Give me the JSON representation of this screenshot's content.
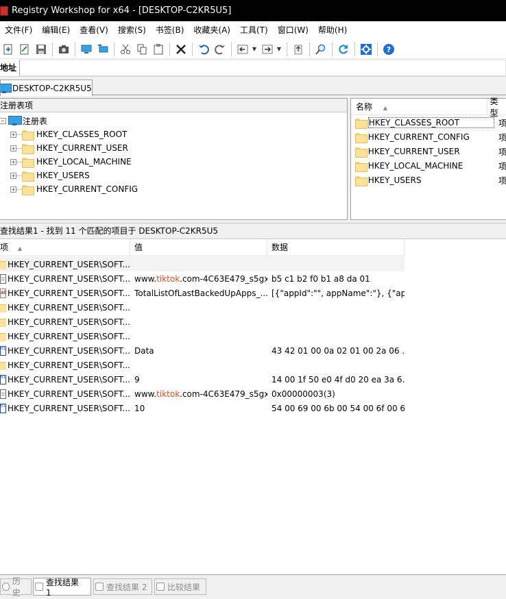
{
  "window": {
    "title": "Registry Workshop for x64 - [DESKTOP-C2KR5U5]"
  },
  "menu": [
    "文件(F)",
    "编辑(E)",
    "查看(V)",
    "搜索(S)",
    "书签(B)",
    "收藏夹(A)",
    "工具(T)",
    "窗口(W)",
    "帮助(H)"
  ],
  "address": {
    "label": "地址",
    "value": ""
  },
  "tab": {
    "label": "DESKTOP-C2KR5U5"
  },
  "tree": {
    "header": "注册表项",
    "root": "注册表",
    "items": [
      "HKEY_CLASSES_ROOT",
      "HKEY_CURRENT_USER",
      "HKEY_LOCAL_MACHINE",
      "HKEY_USERS",
      "HKEY_CURRENT_CONFIG"
    ]
  },
  "list": {
    "col_name": "名称",
    "col_type": "类型",
    "rows": [
      {
        "name": "HKEY_CLASSES_ROOT",
        "type": "项"
      },
      {
        "name": "HKEY_CURRENT_CONFIG",
        "type": "项"
      },
      {
        "name": "HKEY_CURRENT_USER",
        "type": "项"
      },
      {
        "name": "HKEY_LOCAL_MACHINE",
        "type": "项"
      },
      {
        "name": "HKEY_USERS",
        "type": "项"
      }
    ]
  },
  "results": {
    "title": "查找结果1 - 找到 11 个匹配的项目于 DESKTOP-C2KR5U5",
    "col_item": "项",
    "col_value": "值",
    "col_data": "数据",
    "rows": [
      {
        "icon": "folder",
        "item": "HKEY_CURRENT_USER\\SOFT...",
        "value_pre": "",
        "value_hl": "",
        "value_post": "",
        "data": ""
      },
      {
        "icon": "string",
        "item": "HKEY_CURRENT_USER\\SOFT...",
        "value_pre": "www.",
        "value_hl": "tiktok",
        "value_post": ".com-4C63E479_s5gx...",
        "data": "b5 c1 b2 f0 b1 a8 da 01"
      },
      {
        "icon": "ab",
        "item": "HKEY_CURRENT_USER\\SOFT...",
        "value_pre": "TotalListOfLastBackedUpApps_...",
        "value_hl": "",
        "value_post": "",
        "data": "[{\"appId\":\"\", appName\":\"}, {\"ap..."
      },
      {
        "icon": "folder",
        "item": "HKEY_CURRENT_USER\\SOFT...",
        "value_pre": "",
        "value_hl": "",
        "value_post": "",
        "data": ""
      },
      {
        "icon": "folder",
        "item": "HKEY_CURRENT_USER\\SOFT...",
        "value_pre": "",
        "value_hl": "",
        "value_post": "",
        "data": ""
      },
      {
        "icon": "folder",
        "item": "HKEY_CURRENT_USER\\SOFT...",
        "value_pre": "",
        "value_hl": "",
        "value_post": "",
        "data": ""
      },
      {
        "icon": "binary",
        "item": "HKEY_CURRENT_USER\\SOFT...",
        "value_pre": "Data",
        "value_hl": "",
        "value_post": "",
        "data": "43 42 01 00 0a 02 01 00 2a 06 ..."
      },
      {
        "icon": "folder",
        "item": "HKEY_CURRENT_USER\\SOFT...",
        "value_pre": "",
        "value_hl": "",
        "value_post": "",
        "data": ""
      },
      {
        "icon": "binary",
        "item": "HKEY_CURRENT_USER\\SOFT...",
        "value_pre": "9",
        "value_hl": "",
        "value_post": "",
        "data": "14 00 1f 50 e0 4f d0 20 ea 3a 6..."
      },
      {
        "icon": "string",
        "item": "HKEY_CURRENT_USER\\SOFT...",
        "value_pre": "www.",
        "value_hl": "tiktok",
        "value_post": ".com-4C63E479_s5gx...",
        "data": "0x00000003(3)"
      },
      {
        "icon": "binary",
        "item": "HKEY_CURRENT_USER\\SOFT...",
        "value_pre": "10",
        "value_hl": "",
        "value_post": "",
        "data": "54 00 69 00 6b 00 54 00 6f 00 6..."
      }
    ]
  },
  "bottom_tabs": [
    "历史",
    "查找结果 1",
    "查找结果 2",
    "比较结果"
  ],
  "colors": {
    "highlight": "#e8471c",
    "title_bg": "#000000"
  }
}
